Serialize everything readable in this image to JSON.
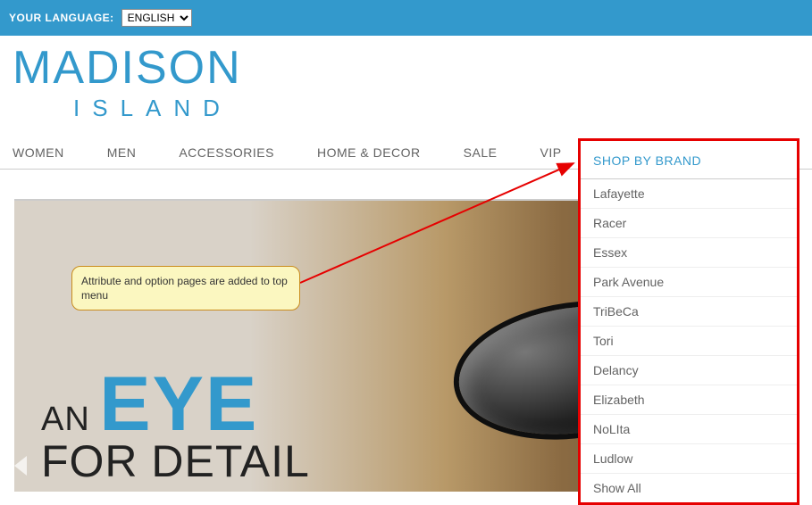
{
  "topbar": {
    "language_label": "YOUR LANGUAGE:",
    "language_value": "ENGLISH"
  },
  "logo": {
    "line1": "MADISON",
    "line2": "ISLAND"
  },
  "nav": {
    "items": [
      {
        "label": "WOMEN"
      },
      {
        "label": "MEN"
      },
      {
        "label": "ACCESSORIES"
      },
      {
        "label": "HOME & DECOR"
      },
      {
        "label": "SALE"
      },
      {
        "label": "VIP"
      }
    ],
    "shop_by_brand": "SHOP BY BRAND"
  },
  "dropdown": {
    "items": [
      {
        "label": "Lafayette"
      },
      {
        "label": "Racer"
      },
      {
        "label": "Essex"
      },
      {
        "label": "Park Avenue"
      },
      {
        "label": "TriBeCa"
      },
      {
        "label": "Tori"
      },
      {
        "label": "Delancy"
      },
      {
        "label": "Elizabeth"
      },
      {
        "label": "NoLIta"
      },
      {
        "label": "Ludlow"
      },
      {
        "label": "Show All"
      }
    ]
  },
  "hero": {
    "small1": "AN",
    "big": "EYE",
    "line2": "FOR DETAIL"
  },
  "callout": {
    "text": "Attribute and option pages are added to top menu"
  },
  "colors": {
    "brand": "#3399cc",
    "annotation_border": "#e60000",
    "callout_bg": "#fbf7c0"
  }
}
